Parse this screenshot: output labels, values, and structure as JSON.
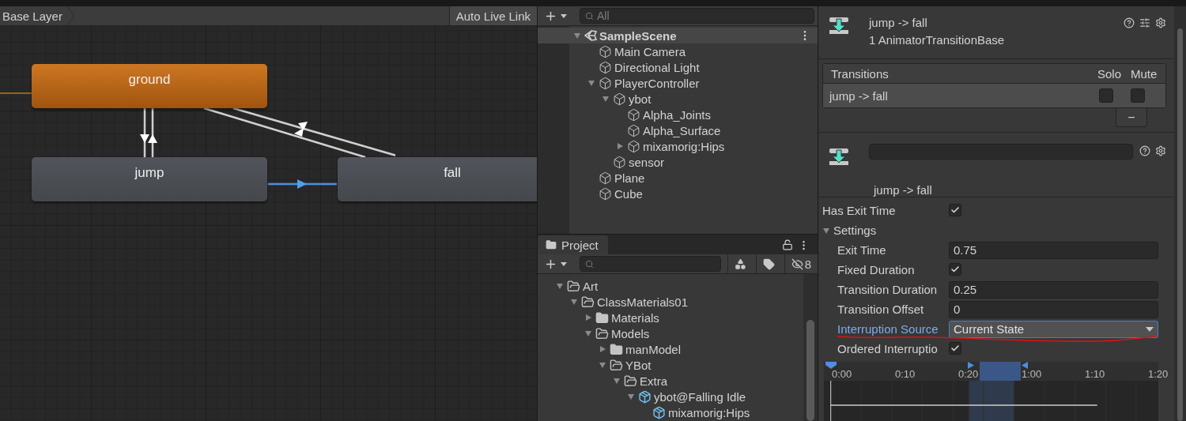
{
  "animator": {
    "breadcrumb": "Base Layer",
    "live_link_button": "Auto Live Link",
    "states": [
      {
        "label": "ground",
        "kind": "default"
      },
      {
        "label": "jump",
        "kind": "state"
      },
      {
        "label": "fall",
        "kind": "state"
      }
    ]
  },
  "hierarchy": {
    "search_placeholder": "All",
    "scene": {
      "label": "SampleScene",
      "kind": "scene",
      "expanded": true,
      "children": [
        {
          "label": "Main Camera",
          "kind": "object"
        },
        {
          "label": "Directional Light",
          "kind": "object"
        },
        {
          "label": "PlayerController",
          "kind": "object",
          "expanded": true,
          "children": [
            {
              "label": "ybot",
              "kind": "object",
              "expanded": true,
              "children": [
                {
                  "label": "Alpha_Joints",
                  "kind": "object"
                },
                {
                  "label": "Alpha_Surface",
                  "kind": "object"
                },
                {
                  "label": "mixamorig:Hips",
                  "kind": "object",
                  "expanded": false
                }
              ]
            },
            {
              "label": "sensor",
              "kind": "object"
            }
          ]
        },
        {
          "label": "Plane",
          "kind": "object"
        },
        {
          "label": "Cube",
          "kind": "object"
        }
      ]
    }
  },
  "project": {
    "tab": "Project",
    "hidden_count": "8",
    "tree": [
      {
        "label": "Art",
        "kind": "folder",
        "expanded": true,
        "children": [
          {
            "label": "ClassMaterials01",
            "kind": "folder",
            "expanded": true,
            "children": [
              {
                "label": "Materials",
                "kind": "folder",
                "expanded": false
              },
              {
                "label": "Models",
                "kind": "folder",
                "expanded": true,
                "children": [
                  {
                    "label": "manModel",
                    "kind": "folder",
                    "expanded": false
                  },
                  {
                    "label": "YBot",
                    "kind": "folder",
                    "expanded": true,
                    "children": [
                      {
                        "label": "Extra",
                        "kind": "folder",
                        "expanded": true,
                        "children": [
                          {
                            "label": "ybot@Falling Idle",
                            "kind": "model",
                            "expanded": true,
                            "children": [
                              {
                                "label": "mixamorig:Hips",
                                "kind": "model"
                              }
                            ]
                          }
                        ]
                      }
                    ]
                  }
                ]
              }
            ]
          }
        ]
      }
    ]
  },
  "inspector": {
    "title": "jump -> fall",
    "subtitle": "1 AnimatorTransitionBase",
    "transitions": {
      "columns": [
        "Transitions",
        "Solo",
        "Mute"
      ],
      "rows": [
        {
          "name": "jump -> fall",
          "solo": false,
          "mute": false,
          "selected": true
        }
      ],
      "remove_button": "−"
    },
    "transition_label": "jump -> fall",
    "properties": [
      {
        "label": "Has Exit Time",
        "kind": "checkbox",
        "checked": true,
        "highlighted": false
      },
      {
        "label": "Settings",
        "kind": "foldout",
        "expanded": true,
        "highlighted": false,
        "children": [
          {
            "label": "Exit Time",
            "kind": "number",
            "value": "0.75",
            "highlighted": false
          },
          {
            "label": "Fixed Duration",
            "kind": "checkbox",
            "checked": true,
            "highlighted": false
          },
          {
            "label": "Transition Duration",
            "kind": "number",
            "value": "0.25",
            "highlighted": false
          },
          {
            "label": "Transition Offset",
            "kind": "number",
            "value": "0",
            "highlighted": false
          },
          {
            "label": "Interruption Source",
            "kind": "dropdown",
            "value": "Current State",
            "highlighted": true
          },
          {
            "label": "Ordered Interruptio",
            "kind": "checkbox",
            "checked": true,
            "highlighted": false
          }
        ]
      }
    ],
    "timeline": {
      "ticks": [
        "0:00",
        "0:10",
        "0:20",
        "1:00",
        "1:10",
        "1:20"
      ]
    }
  }
}
